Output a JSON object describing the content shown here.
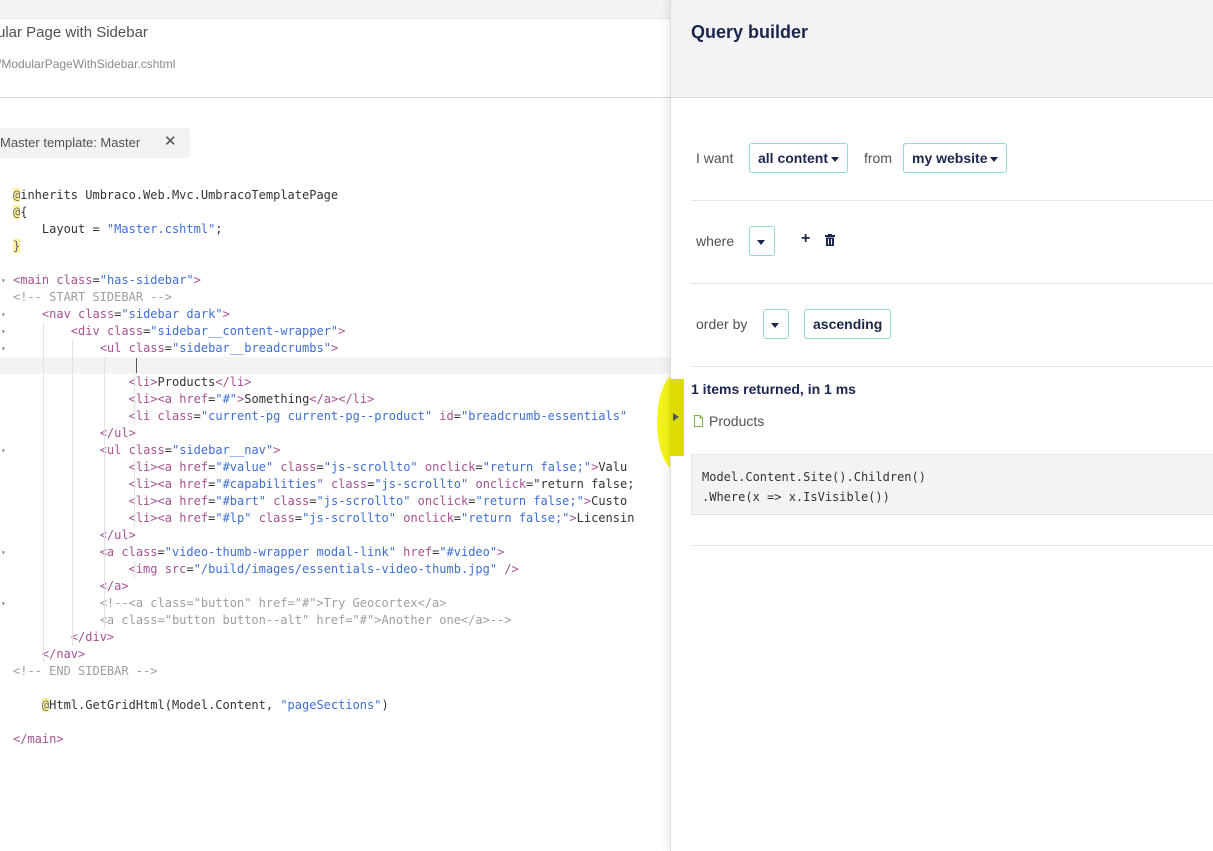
{
  "editor": {
    "template_name": "ular Page with Sidebar",
    "template_path": "/ModularPageWithSidebar.cshtml",
    "master_template_label": "Master template: Master",
    "master_remove_icon": "close-icon",
    "code_lines": [
      "@inherits Umbraco.Web.Mvc.UmbracoTemplatePage",
      "@{",
      "    Layout = \"Master.cshtml\";",
      "}",
      "",
      "<main class=\"has-sidebar\">",
      "<!-- START SIDEBAR -->",
      "    <nav class=\"sidebar dark\">",
      "        <div class=\"sidebar__content-wrapper\">",
      "            <ul class=\"sidebar__breadcrumbs\">",
      "",
      "                <li>Products</li>",
      "                <li><a href=\"#\">Something</a></li>",
      "                <li class=\"current-pg current-pg--product\" id=\"breadcrumb-essentials\"",
      "            </ul>",
      "            <ul class=\"sidebar__nav\">",
      "                <li><a href=\"#value\" class=\"js-scrollto\" onclick=\"return false;\">Valu",
      "                <li><a href=\"#capabilities\" class=\"js-scrollto\" onclick=\"return false;",
      "                <li><a href=\"#bart\" class=\"js-scrollto\" onclick=\"return false;\">Custo",
      "                <li><a href=\"#lp\" class=\"js-scrollto\" onclick=\"return false;\">Licensin",
      "            </ul>",
      "            <a class=\"video-thumb-wrapper modal-link\" href=\"#video\">",
      "                <img src=\"/build/images/essentials-video-thumb.jpg\" />",
      "            </a>",
      "            <!--<a class=\"button\" href=\"#\">Try Geocortex</a>",
      "            <a class=\"button button--alt\" href=\"#\">Another one</a>-->",
      "        </div>",
      "    </nav>",
      "<!-- END SIDEBAR -->",
      "",
      "    @Html.GetGridHtml(Model.Content, \"pageSections\")",
      "",
      "</main>"
    ]
  },
  "query_builder": {
    "title": "Query builder",
    "i_want_label": "I want",
    "content_type_value": "all content",
    "from_label": "from",
    "source_value": "my website",
    "where_label": "where",
    "where_value": "",
    "add_condition_icon": "plus-icon",
    "remove_condition_icon": "trash-icon",
    "order_by_label": "order by",
    "order_by_value": "",
    "sort_direction": "ascending",
    "results_summary": "1 items returned, in 1 ms",
    "results": [
      {
        "icon": "document-icon",
        "name": "Products"
      }
    ],
    "query_lines": [
      "Model.Content.Site().Children()",
      ".Where(x => x.IsVisible())"
    ],
    "colors": {
      "accent_border": "#8fd9d9",
      "title_color": "#1b264f",
      "result_icon": "#7ab648",
      "highlight": "#f3f300"
    }
  },
  "splitter": {
    "collapse_icon": "chevron-right-icon"
  }
}
